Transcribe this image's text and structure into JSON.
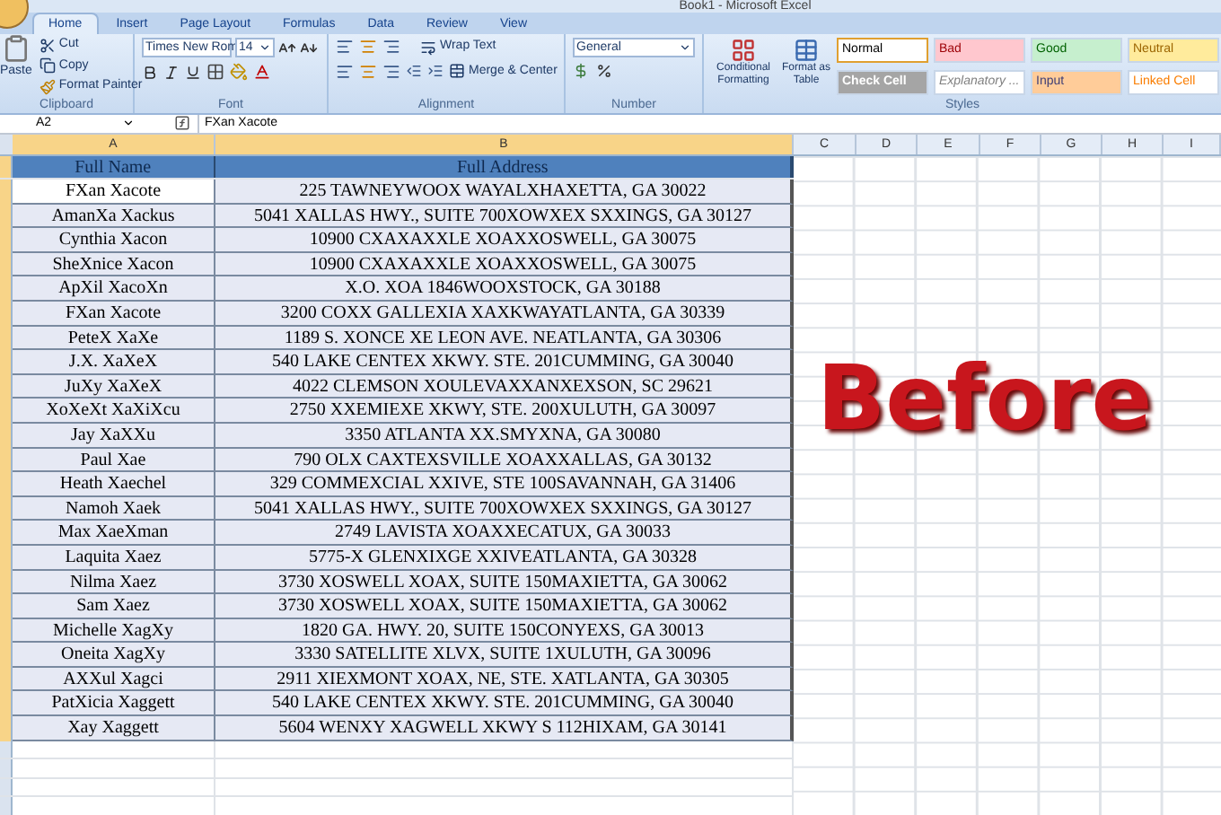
{
  "window": {
    "title": "Book1 - Microsoft Excel"
  },
  "ribbon_tabs": [
    {
      "label": "Home",
      "selected": true
    },
    {
      "label": "Insert",
      "selected": false
    },
    {
      "label": "Page Layout",
      "selected": false
    },
    {
      "label": "Formulas",
      "selected": false
    },
    {
      "label": "Data",
      "selected": false
    },
    {
      "label": "Review",
      "selected": false
    },
    {
      "label": "View",
      "selected": false
    }
  ],
  "clipboard": {
    "paste": "Paste",
    "cut": "Cut",
    "copy": "Copy",
    "format_painter": "Format Painter",
    "label": "Clipboard"
  },
  "font": {
    "name": "Times New Rom",
    "size": "14",
    "label": "Font"
  },
  "alignment": {
    "wrap": "Wrap Text",
    "merge": "Merge & Center",
    "label": "Alignment"
  },
  "number": {
    "format": "General",
    "label": "Number"
  },
  "styles": {
    "conditional": "Conditional Formatting",
    "format_table": "Format as Table",
    "label": "Styles",
    "gallery": [
      {
        "label": "Normal",
        "kind": "normal",
        "selected": true
      },
      {
        "label": "Bad",
        "kind": "bad",
        "selected": false
      },
      {
        "label": "Good",
        "kind": "good",
        "selected": false
      },
      {
        "label": "Neutral",
        "kind": "neutral",
        "selected": false
      },
      {
        "label": "Check Cell",
        "kind": "check",
        "selected": false
      },
      {
        "label": "Explanatory ...",
        "kind": "explanatory",
        "selected": false
      },
      {
        "label": "Input",
        "kind": "input",
        "selected": false
      },
      {
        "label": "Linked Cell",
        "kind": "linked",
        "selected": false
      }
    ]
  },
  "formula_bar": {
    "name_box": "A2",
    "value": "FXan Xacote"
  },
  "columns": [
    {
      "label": "A",
      "selected": true
    },
    {
      "label": "B",
      "selected": true
    },
    {
      "label": "C",
      "selected": false
    },
    {
      "label": "D",
      "selected": false
    },
    {
      "label": "E",
      "selected": false
    },
    {
      "label": "F",
      "selected": false
    },
    {
      "label": "G",
      "selected": false
    },
    {
      "label": "H",
      "selected": false
    },
    {
      "label": "I",
      "selected": false
    }
  ],
  "header": [
    "Full  Name",
    "Full Address"
  ],
  "rows": [
    {
      "name": "FXan Xacote",
      "address": "225 TAWNEYWOOX WAYALXHAXETTA, GA 30022",
      "selected": true
    },
    {
      "name": "AmanXa Xackus",
      "address": "5041 XALLAS HWY., SUITE 700XOWXEX SXXINGS, GA 30127",
      "selected": false
    },
    {
      "name": "Cynthia Xacon",
      "address": "10900 CXAXAXXLE XOAXXOSWELL, GA 30075",
      "selected": false
    },
    {
      "name": "SheXnice Xacon",
      "address": "10900 CXAXAXXLE XOAXXOSWELL, GA 30075",
      "selected": false
    },
    {
      "name": "ApXil XacoXn",
      "address": "X.O. XOA 1846WOOXSTOCK, GA 30188",
      "selected": false
    },
    {
      "name": "FXan Xacote",
      "address": "3200 COXX GALLEXIA XAXKWAYATLANTA, GA 30339",
      "selected": false
    },
    {
      "name": "PeteX XaXe",
      "address": "1189 S. XONCE XE LEON AVE. NEATLANTA, GA 30306",
      "selected": false
    },
    {
      "name": "J.X. XaXeX",
      "address": "540 LAKE CENTEX XKWY. STE. 201CUMMING, GA 30040",
      "selected": false
    },
    {
      "name": "JuXy XaXeX",
      "address": "4022 CLEMSON XOULEVAXXANXEXSON, SC 29621",
      "selected": false
    },
    {
      "name": "XoXeXt XaXiXcu",
      "address": "2750 XXEMIEXE XKWY, STE. 200XULUTH, GA 30097",
      "selected": false
    },
    {
      "name": "Jay XaXXu",
      "address": "3350 ATLANTA XX.SMYXNA, GA 30080",
      "selected": false
    },
    {
      "name": "Paul Xae",
      "address": "790 OLX CAXTEXSVILLE XOAXXALLAS, GA 30132",
      "selected": false
    },
    {
      "name": "Heath Xaechel",
      "address": "329 COMMEXCIAL XXIVE, STE 100SAVANNAH, GA 31406",
      "selected": false
    },
    {
      "name": "Namoh Xaek",
      "address": "5041 XALLAS HWY., SUITE 700XOWXEX SXXINGS, GA 30127",
      "selected": false
    },
    {
      "name": "Max XaeXman",
      "address": "2749 LAVISTA XOAXXECATUX, GA 30033",
      "selected": false
    },
    {
      "name": "Laquita Xaez",
      "address": "5775-X GLENXIXGE XXIVEATLANTA, GA 30328",
      "selected": false
    },
    {
      "name": "Nilma Xaez",
      "address": "3730 XOSWELL XOAX, SUITE 150MAXIETTA, GA 30062",
      "selected": false
    },
    {
      "name": "Sam Xaez",
      "address": "3730 XOSWELL XOAX, SUITE 150MAXIETTA, GA 30062",
      "selected": false
    },
    {
      "name": "Michelle XagXy",
      "address": "1820 GA. HWY. 20, SUITE 150CONYEXS, GA 30013",
      "selected": false
    },
    {
      "name": "Oneita XagXy",
      "address": "3330 SATELLITE XLVX, SUITE 1XULUTH, GA 30096",
      "selected": false
    },
    {
      "name": "AXXul Xagci",
      "address": "2911 XIEXMONT XOAX, NE, STE. XATLANTA, GA 30305",
      "selected": false
    },
    {
      "name": "PatXicia Xaggett",
      "address": "540 LAKE CENTEX XKWY. STE. 201CUMMING, GA 30040",
      "selected": false
    },
    {
      "name": "Xay Xaggett",
      "address": "5604 WENXY XAGWELL XKWY S 112HIXAM, GA 30141",
      "selected": false
    }
  ],
  "overlay_caption": "Before"
}
